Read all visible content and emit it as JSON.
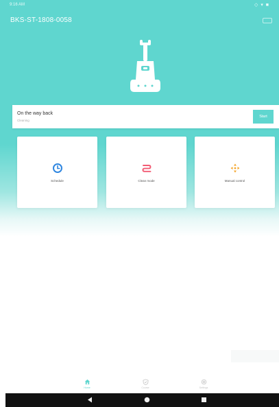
{
  "status_bar": {
    "time": "9:16 AM",
    "indicators": "◇ ▾ ■"
  },
  "header": {
    "device_id": "BKS-ST-1808-0058"
  },
  "robot": {
    "icon": "floor-scrubber-robot-icon",
    "color": "#ffffff"
  },
  "status_card": {
    "status": "On the way back",
    "substatus": "Cleaning",
    "start_label": "Start"
  },
  "actions": [
    {
      "label": "Schedule",
      "icon": "clock-icon",
      "color": "#2f86e0"
    },
    {
      "label": "Clean mode",
      "icon": "clean-mode-icon",
      "color": "#f25b73"
    },
    {
      "label": "Manual control",
      "icon": "dpad-icon",
      "color": "#f4a52a"
    }
  ],
  "bottom_nav": [
    {
      "label": "Home",
      "icon": "home-icon",
      "active": true
    },
    {
      "label": "Course",
      "icon": "course-icon",
      "active": false
    },
    {
      "label": "Settings",
      "icon": "settings-icon",
      "active": false
    }
  ],
  "theme": {
    "accent": "#5fd6cf",
    "nav_inactive": "#c4c4c4"
  }
}
